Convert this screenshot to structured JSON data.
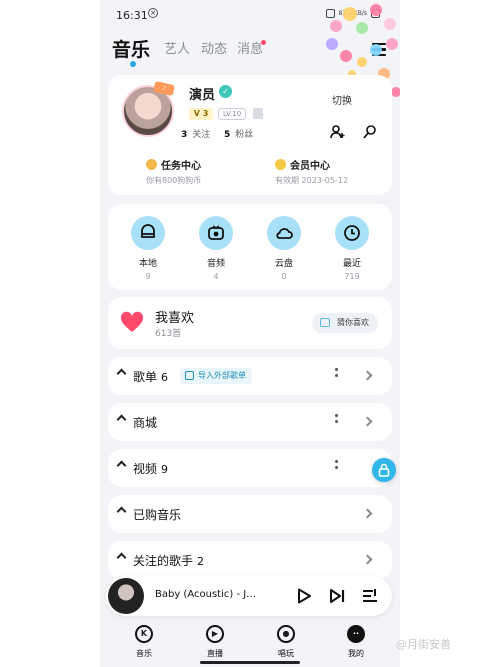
{
  "status_bar": {
    "time": "16:31",
    "notification_icon": "circle-x-icon",
    "network": "87.2 KB/s"
  },
  "header": {
    "tabs": [
      {
        "label": "音乐",
        "active": true
      },
      {
        "label": "艺人",
        "active": false
      },
      {
        "label": "动态",
        "active": false
      },
      {
        "label": "消息",
        "active": false
      }
    ],
    "menu_icon": "menu-icon"
  },
  "profile": {
    "name": "演员",
    "vip_level": "3",
    "lv_label": "LV.10",
    "following_count": "3",
    "following_label": "关注",
    "fans_count": "5",
    "fans_label": "粉丝",
    "switch_label": "切换",
    "tasks": {
      "title": "任务中心",
      "subtitle": "你有800狗狗币"
    },
    "member": {
      "title": "会员中心",
      "subtitle": "有效期 2023-05-12"
    }
  },
  "quick_access": [
    {
      "label": "本地",
      "count": "9",
      "icon": "local-icon"
    },
    {
      "label": "音频",
      "count": "4",
      "icon": "audio-icon"
    },
    {
      "label": "云盘",
      "count": "0",
      "icon": "cloud-icon"
    },
    {
      "label": "最近",
      "count": "719",
      "icon": "clock-icon"
    }
  ],
  "likes": {
    "title": "我喜欢",
    "count": "613首",
    "guess_label": "猜你喜欢"
  },
  "sections": {
    "playlist": {
      "title": "歌单",
      "count": "6",
      "import_label": "导入外部歌单"
    },
    "store": {
      "title": "商城"
    },
    "video": {
      "title": "视频",
      "count": "9"
    },
    "purchased": {
      "title": "已购音乐"
    },
    "artists": {
      "title": "关注的歌手",
      "count": "2"
    }
  },
  "player": {
    "title": "Baby (Acoustic) - J…"
  },
  "bottom_nav": [
    {
      "label": "音乐",
      "icon": "k-icon"
    },
    {
      "label": "直播",
      "icon": "live-icon"
    },
    {
      "label": "唱玩",
      "icon": "mic-icon"
    },
    {
      "label": "我的",
      "icon": "me-icon"
    }
  ],
  "watermark": "@月街安善",
  "colors": {
    "accent": "#2aa9e0",
    "quick_icon_bg": "#a8e1f7",
    "heart": "#ff4a6b",
    "page_bg": "#f3f4f8"
  }
}
